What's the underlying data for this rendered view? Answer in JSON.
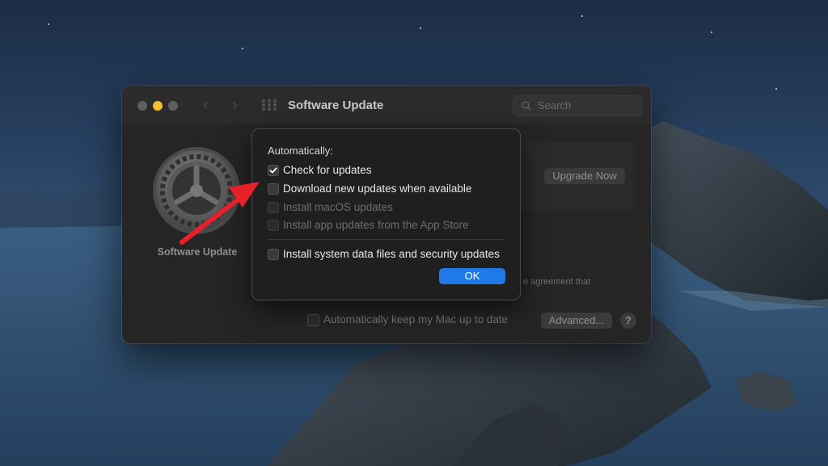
{
  "window": {
    "title": "Software Update",
    "search_placeholder": "Search"
  },
  "app_panel": {
    "label": "Software Update",
    "icon": "gear-icon"
  },
  "upgrade": {
    "button_label": "Upgrade Now"
  },
  "background": {
    "agreement_text": "e agreement that",
    "auto_keep_label": "Automatically keep my Mac up to date",
    "auto_keep_checked": false,
    "advanced_label": "Advanced...",
    "help_label": "?"
  },
  "sheet": {
    "heading": "Automatically:",
    "options": [
      {
        "label": "Check for updates",
        "checked": true,
        "enabled": true
      },
      {
        "label": "Download new updates when available",
        "checked": false,
        "enabled": true
      },
      {
        "label": "Install macOS updates",
        "checked": false,
        "enabled": false
      },
      {
        "label": "Install app updates from the App Store",
        "checked": false,
        "enabled": false
      },
      {
        "label": "Install system data files and security updates",
        "checked": false,
        "enabled": true
      }
    ],
    "ok_label": "OK"
  },
  "colors": {
    "accent": "#1f7ae8",
    "annotation_arrow": "#e8202a",
    "minimize_light": "#f6be2f"
  }
}
